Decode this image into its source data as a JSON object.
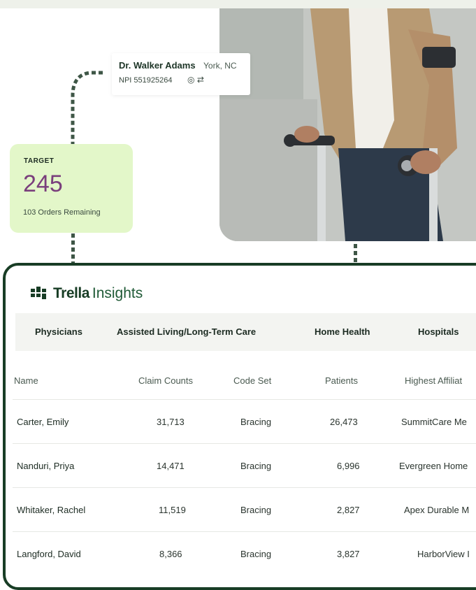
{
  "doctor": {
    "name": "Dr. Walker Adams",
    "location": "York, NC",
    "npi": "NPI 551925264"
  },
  "target": {
    "label": "TARGET",
    "value": "245",
    "remaining": "103 Orders Remaining"
  },
  "brand": {
    "word1": "Trella",
    "word2": "Insights"
  },
  "tabs": [
    "Physicians",
    "Assisted Living/Long-Term Care",
    "Home Health",
    "Hospitals"
  ],
  "table": {
    "headers": [
      "Name",
      "Claim Counts",
      "Code Set",
      "Patients",
      "Highest Affiliat"
    ],
    "rows": [
      {
        "name": "Carter, Emily",
        "claims": "31,713",
        "code": "Bracing",
        "patients": "26,473",
        "affiliate": "SummitCare Me"
      },
      {
        "name": "Nanduri, Priya",
        "claims": "14,471",
        "code": "Bracing",
        "patients": "6,996",
        "affiliate": "Evergreen Home"
      },
      {
        "name": "Whitaker, Rachel",
        "claims": "11,519",
        "code": "Bracing",
        "patients": "2,827",
        "affiliate": "Apex Durable M"
      },
      {
        "name": "Langford, David",
        "claims": "8,366",
        "code": "Bracing",
        "patients": "3,827",
        "affiliate": "HarborView I"
      }
    ]
  },
  "icons": [
    "target-icon",
    "repeat-icon",
    "trella-logo-icon"
  ],
  "colors": {
    "brand_green": "#183d25",
    "target_bg": "#e3f7c9",
    "target_value": "#7a3f7c"
  }
}
